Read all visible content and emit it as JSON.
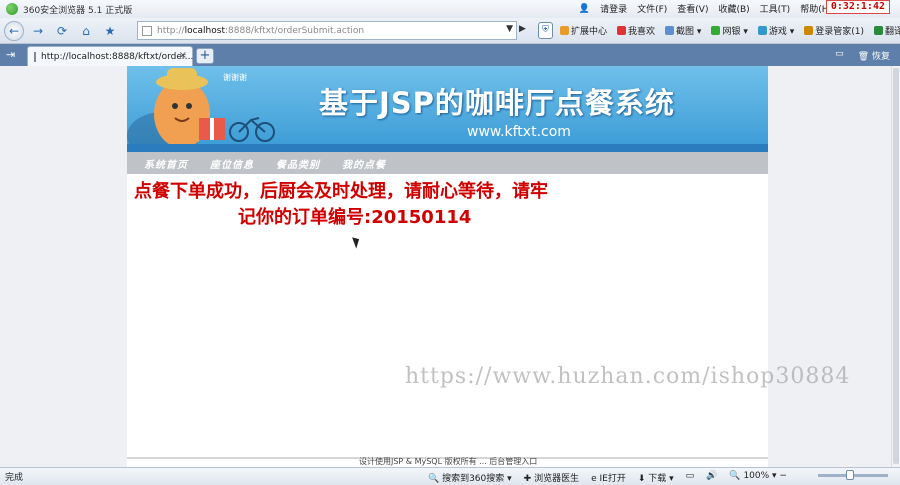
{
  "browser": {
    "title": "360安全浏览器 5.1 正式版",
    "clock": "0:32:1:42",
    "login": "请登录",
    "menu": [
      "文件(F)",
      "查看(V)",
      "收藏(B)",
      "工具(T)",
      "帮助(H)"
    ],
    "address": {
      "prefix": "http://",
      "host": "localhost",
      "rest": ":8888/kftxt/orderSubmit.action"
    },
    "tools": [
      "扩展中心",
      "我喜欢",
      "截图",
      "网银",
      "游戏",
      "登录管家(1)",
      "翻译"
    ],
    "tab": {
      "label": "http://localhost:8888/kftxt/order...",
      "close": "×"
    },
    "new_tab": "+",
    "tabbar_right": "恢复",
    "status": {
      "done": "完成",
      "search": "搜索到360搜索",
      "doctor": "浏览器医生",
      "ie": "IE打开",
      "download": "下载",
      "zoom": "100%"
    }
  },
  "site": {
    "banner_title": "基于JSP的咖啡厅点餐系统",
    "banner_url": "www.kftxt.com",
    "banner_bubble": "谢谢谢",
    "nav": [
      "系统首页",
      "座位信息",
      "餐品类别",
      "我的点餐"
    ],
    "message_line1": "点餐下单成功，后厨会及时处理，请耐心等待，请牢",
    "message_line2": "记你的订单编号",
    "order_no": ":20150114",
    "footer": "设计使用JSP & MySQL 版权所有 ... 后台管理入口"
  },
  "watermark": "https://www.huzhan.com/ishop30884"
}
